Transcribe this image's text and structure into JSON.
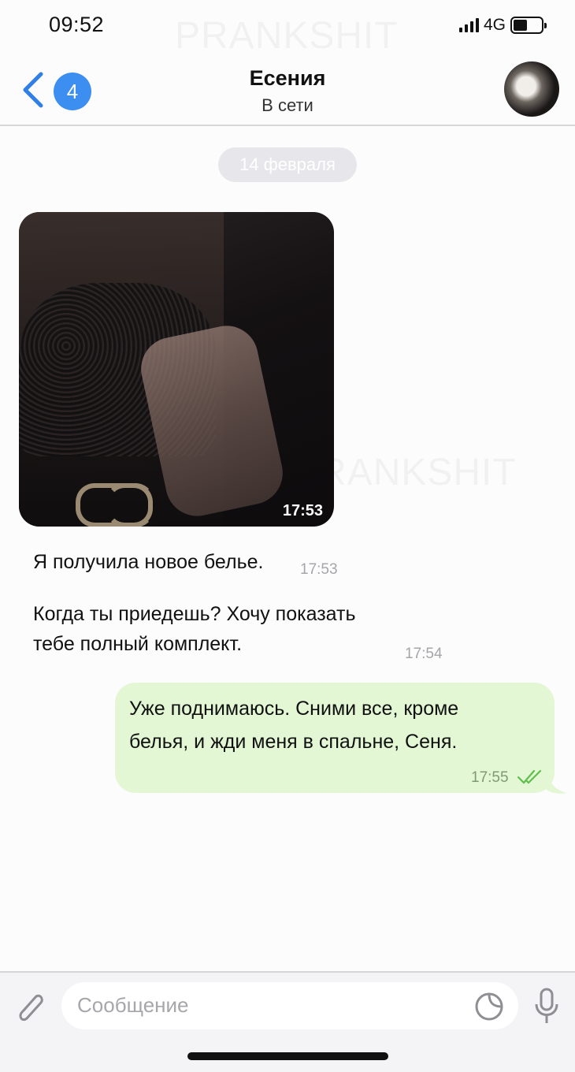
{
  "status_bar": {
    "time": "09:52",
    "network": "4G"
  },
  "header": {
    "back_badge": "4",
    "contact_name": "Есения",
    "contact_status": "В сети"
  },
  "watermark": "PRANKSHIT",
  "chat": {
    "date_label": "14 февраля",
    "photo_time": "17:53",
    "incoming": [
      {
        "text": "Я получила новое белье.",
        "time": "17:53"
      },
      {
        "line1": "Когда ты приедешь? Хочу показать",
        "line2": "тебе полный комплект.",
        "time": "17:54"
      }
    ],
    "outgoing": {
      "line1": "Уже поднимаюсь. Сними все, кроме",
      "line2": "белья, и жди меня в спальне, Сеня.",
      "time": "17:55"
    }
  },
  "composer": {
    "placeholder": "Сообщение"
  },
  "colors": {
    "accent": "#3c8ef0",
    "outgoing_bubble": "#e3f7d4",
    "ticks": "#5fbf4a"
  },
  "icons": [
    "chevron-left-icon",
    "paperclip-icon",
    "sticker-icon",
    "microphone-icon",
    "signal-icon",
    "battery-icon",
    "double-check-icon"
  ]
}
